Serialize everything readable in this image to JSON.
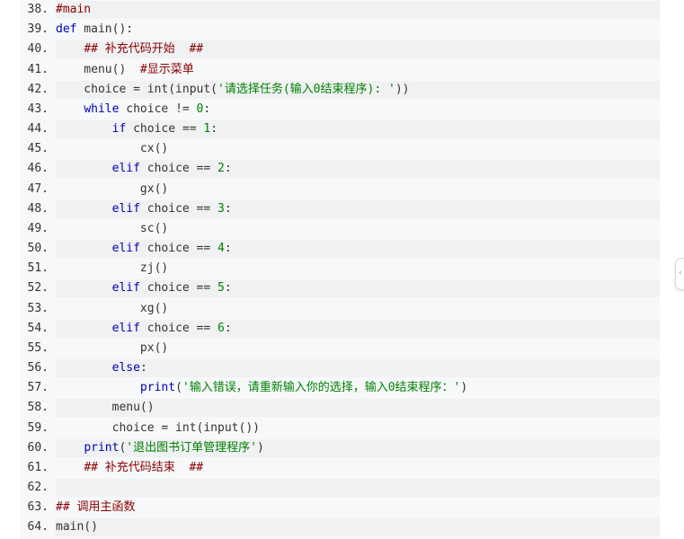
{
  "lines": [
    {
      "num": "38.",
      "tokens": [
        {
          "t": "#main",
          "c": "cm"
        }
      ]
    },
    {
      "num": "39.",
      "tokens": [
        {
          "t": "def",
          "c": "kw"
        },
        {
          "t": " main():",
          "c": "op"
        }
      ]
    },
    {
      "num": "40.",
      "tokens": [
        {
          "t": "    ",
          "c": "op"
        },
        {
          "t": "## 补充代码开始  ##",
          "c": "cm"
        }
      ]
    },
    {
      "num": "41.",
      "tokens": [
        {
          "t": "    menu()  ",
          "c": "op"
        },
        {
          "t": "#显示菜单",
          "c": "cm"
        }
      ]
    },
    {
      "num": "42.",
      "tokens": [
        {
          "t": "    choice = int(input(",
          "c": "op"
        },
        {
          "t": "'请选择任务(输入0结束程序): '",
          "c": "st"
        },
        {
          "t": "))",
          "c": "op"
        }
      ]
    },
    {
      "num": "43.",
      "tokens": [
        {
          "t": "    ",
          "c": "op"
        },
        {
          "t": "while",
          "c": "kw"
        },
        {
          "t": " choice != ",
          "c": "op"
        },
        {
          "t": "0",
          "c": "nu"
        },
        {
          "t": ":",
          "c": "op"
        }
      ]
    },
    {
      "num": "44.",
      "tokens": [
        {
          "t": "        ",
          "c": "op"
        },
        {
          "t": "if",
          "c": "kw"
        },
        {
          "t": " choice == ",
          "c": "op"
        },
        {
          "t": "1",
          "c": "nu"
        },
        {
          "t": ":",
          "c": "op"
        }
      ]
    },
    {
      "num": "45.",
      "tokens": [
        {
          "t": "            cx()",
          "c": "op"
        }
      ]
    },
    {
      "num": "46.",
      "tokens": [
        {
          "t": "        ",
          "c": "op"
        },
        {
          "t": "elif",
          "c": "kw"
        },
        {
          "t": " choice == ",
          "c": "op"
        },
        {
          "t": "2",
          "c": "nu"
        },
        {
          "t": ":",
          "c": "op"
        }
      ]
    },
    {
      "num": "47.",
      "tokens": [
        {
          "t": "            gx()",
          "c": "op"
        }
      ]
    },
    {
      "num": "48.",
      "tokens": [
        {
          "t": "        ",
          "c": "op"
        },
        {
          "t": "elif",
          "c": "kw"
        },
        {
          "t": " choice == ",
          "c": "op"
        },
        {
          "t": "3",
          "c": "nu"
        },
        {
          "t": ":",
          "c": "op"
        }
      ]
    },
    {
      "num": "49.",
      "tokens": [
        {
          "t": "            sc()",
          "c": "op"
        }
      ]
    },
    {
      "num": "50.",
      "tokens": [
        {
          "t": "        ",
          "c": "op"
        },
        {
          "t": "elif",
          "c": "kw"
        },
        {
          "t": " choice == ",
          "c": "op"
        },
        {
          "t": "4",
          "c": "nu"
        },
        {
          "t": ":",
          "c": "op"
        }
      ]
    },
    {
      "num": "51.",
      "tokens": [
        {
          "t": "            zj()",
          "c": "op"
        }
      ]
    },
    {
      "num": "52.",
      "tokens": [
        {
          "t": "        ",
          "c": "op"
        },
        {
          "t": "elif",
          "c": "kw"
        },
        {
          "t": " choice == ",
          "c": "op"
        },
        {
          "t": "5",
          "c": "nu"
        },
        {
          "t": ":",
          "c": "op"
        }
      ]
    },
    {
      "num": "53.",
      "tokens": [
        {
          "t": "            xg()",
          "c": "op"
        }
      ]
    },
    {
      "num": "54.",
      "tokens": [
        {
          "t": "        ",
          "c": "op"
        },
        {
          "t": "elif",
          "c": "kw"
        },
        {
          "t": " choice == ",
          "c": "op"
        },
        {
          "t": "6",
          "c": "nu"
        },
        {
          "t": ":",
          "c": "op"
        }
      ]
    },
    {
      "num": "55.",
      "tokens": [
        {
          "t": "            px()",
          "c": "op"
        }
      ]
    },
    {
      "num": "56.",
      "tokens": [
        {
          "t": "        ",
          "c": "op"
        },
        {
          "t": "else",
          "c": "kw"
        },
        {
          "t": ":",
          "c": "op"
        }
      ]
    },
    {
      "num": "57.",
      "tokens": [
        {
          "t": "            ",
          "c": "op"
        },
        {
          "t": "print",
          "c": "kw"
        },
        {
          "t": "(",
          "c": "op"
        },
        {
          "t": "'输入错误，请重新输入你的选择，输入0结束程序：'",
          "c": "st"
        },
        {
          "t": ")",
          "c": "op"
        }
      ]
    },
    {
      "num": "58.",
      "tokens": [
        {
          "t": "        menu()",
          "c": "op"
        }
      ]
    },
    {
      "num": "59.",
      "tokens": [
        {
          "t": "        choice = int(input())",
          "c": "op"
        }
      ]
    },
    {
      "num": "60.",
      "tokens": [
        {
          "t": "    ",
          "c": "op"
        },
        {
          "t": "print",
          "c": "kw"
        },
        {
          "t": "(",
          "c": "op"
        },
        {
          "t": "'退出图书订单管理程序'",
          "c": "st"
        },
        {
          "t": ")",
          "c": "op"
        }
      ]
    },
    {
      "num": "61.",
      "tokens": [
        {
          "t": "    ",
          "c": "op"
        },
        {
          "t": "## 补充代码结束  ##",
          "c": "cm"
        }
      ]
    },
    {
      "num": "62.",
      "tokens": [
        {
          "t": "",
          "c": "op"
        }
      ]
    },
    {
      "num": "63.",
      "tokens": [
        {
          "t": "## 调用主函数",
          "c": "cm"
        }
      ]
    },
    {
      "num": "64.",
      "tokens": [
        {
          "t": "main()",
          "c": "op"
        }
      ]
    }
  ],
  "side_tab": {
    "icon": "chevron-left-icon",
    "glyph": "‹"
  }
}
